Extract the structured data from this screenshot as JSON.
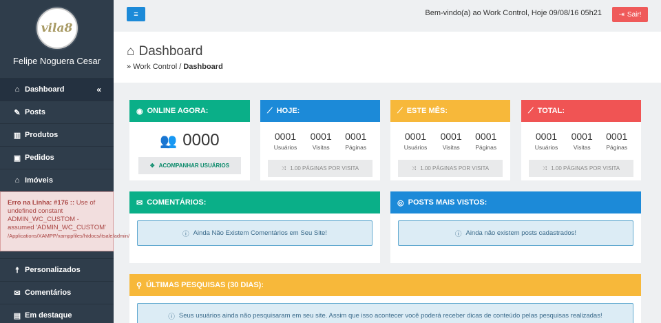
{
  "sidebar": {
    "logo_text": "vila8",
    "user_name": "Felipe Noguera Cesar",
    "items": [
      {
        "label": "Dashboard",
        "icon": "home-icon"
      },
      {
        "label": "Posts",
        "icon": "thumbtack-icon"
      },
      {
        "label": "Produtos",
        "icon": "books-icon"
      },
      {
        "label": "Pedidos",
        "icon": "cart-icon"
      },
      {
        "label": "Imóveis",
        "icon": "home-icon"
      }
    ],
    "collapse_glyph": "«",
    "items2": [
      {
        "label": "Personalizados",
        "icon": "accessibility-icon"
      },
      {
        "label": "Comentários",
        "icon": "comments-icon"
      },
      {
        "label": "Em destaque",
        "icon": "book-icon"
      }
    ]
  },
  "error": {
    "prefix": "Erro na Linha: #176 ::",
    "message": " Use of undefined constant ADMIN_WC_CUSTOM - assumed 'ADMIN_WC_CUSTOM'",
    "path": "/Applications/XAMPP/xamppfiles/htdocs/itsale/admin/dashboard.php"
  },
  "topbar": {
    "welcome": "Bem-vindo(a) ao Work Control, Hoje 09/08/16 05h21",
    "logout_label": "Sair!"
  },
  "header": {
    "title": "Dashboard",
    "crumb_prefix": "» Work Control  /",
    "crumb_current": "Dashboard"
  },
  "online": {
    "title": "ONLINE AGORA:",
    "count": "0000",
    "button": "ACOMPANHAR USUÁRIOS"
  },
  "stat_boxes": [
    {
      "title": "HOJE:",
      "color": "#1c8ad8",
      "values": [
        "0001",
        "0001",
        "0001"
      ],
      "labels": [
        "Usuários",
        "Visitas",
        "Páginas"
      ],
      "footer": "1.00 PÁGINAS POR VISITA"
    },
    {
      "title": "ESTE MÊS:",
      "color": "#f7b83a",
      "values": [
        "0001",
        "0001",
        "0001"
      ],
      "labels": [
        "Usuários",
        "Visitas",
        "Páginas"
      ],
      "footer": "1.00 PÁGINAS POR VISITA"
    },
    {
      "title": "TOTAL:",
      "color": "#f05454",
      "values": [
        "0001",
        "0001",
        "0001"
      ],
      "labels": [
        "Usuários",
        "Visitas",
        "Páginas"
      ],
      "footer": "1.00 PÁGINAS POR VISITA"
    }
  ],
  "comments": {
    "title": "COMENTÁRIOS:",
    "message": "Ainda Não Existem Comentários em Seu Site!"
  },
  "posts": {
    "title": "POSTS MAIS VISTOS:",
    "message": "Ainda não existem posts cadastrados!"
  },
  "searches": {
    "title": "ÚLTIMAS PESQUISAS (30 DIAS):",
    "message": "Seus usuários ainda não pesquisaram em seu site. Assim que isso acontecer você poderá receber dicas de conteúdo pelas pesquisas realizadas!"
  }
}
